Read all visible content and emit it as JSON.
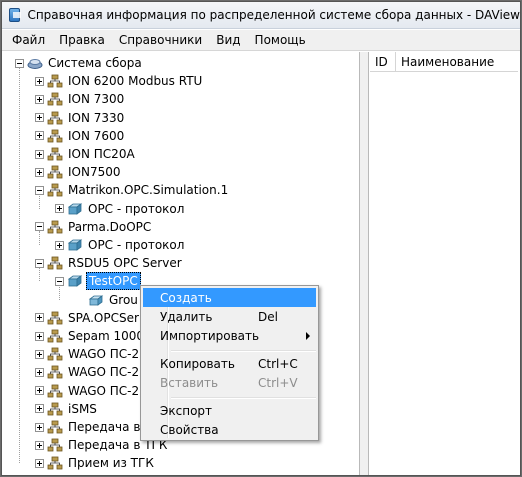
{
  "window": {
    "title": "Справочная информация по распределенной системе сбора данных - DAView"
  },
  "menubar": {
    "items": [
      "Файл",
      "Правка",
      "Справочники",
      "Вид",
      "Помощь"
    ]
  },
  "grid": {
    "columns": [
      "ID",
      "Наименование"
    ]
  },
  "tree": {
    "root": "Система сбора",
    "items": [
      "ION 6200 Modbus RTU",
      "ION 7300",
      "ION 7330",
      "ION 7600",
      "ION ПС20А",
      "ION7500",
      "Matrikon.OPC.Simulation.1",
      "OPC - протокол",
      "Parma.DoOPC",
      "OPC - протокол",
      "RSDU5 OPC Server",
      "TestOPC",
      "Grou",
      "SPA.OPCSer",
      "Sepam 1000-",
      "WAGO ПС-2",
      "WAGO ПС-2",
      "WAGO ПС-2",
      "iSMS",
      "Передача в",
      "Передача в ТГК",
      "Прием из ТГК"
    ]
  },
  "context_menu": {
    "create": "Создать",
    "delete": "Удалить",
    "delete_shortcut": "Del",
    "import": "Импортировать",
    "copy": "Копировать",
    "copy_shortcut": "Ctrl+C",
    "paste": "Вставить",
    "paste_shortcut": "Ctrl+V",
    "export": "Экспорт",
    "properties": "Свойства"
  },
  "colors": {
    "selection": "#3399ff",
    "menu_background": "#f0f0f0",
    "folder_icon": "#b89a4e",
    "opc_icon": "#5aa0c8"
  },
  "icons": {
    "root": "network-root-icon",
    "device": "device-node-icon",
    "protocol": "opc-protocol-icon",
    "group": "group-icon"
  }
}
